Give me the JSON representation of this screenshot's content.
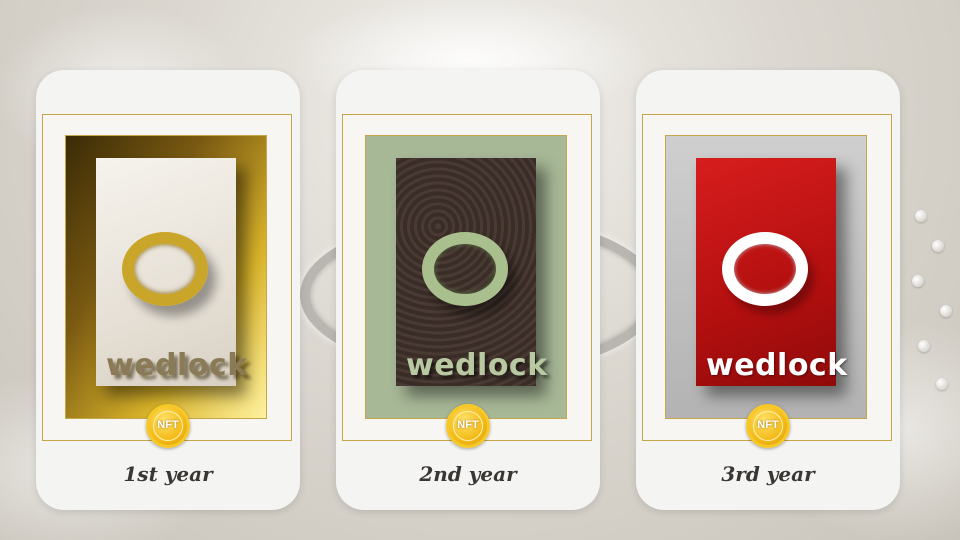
{
  "cards": [
    {
      "logo_text": "wedlock",
      "badge": "NFT",
      "caption": "1st year"
    },
    {
      "logo_text": "wedlock",
      "badge": "NFT",
      "caption": "2nd year"
    },
    {
      "logo_text": "wedlock",
      "badge": "NFT",
      "caption": "3rd year"
    }
  ],
  "colors": {
    "accent_gold": "#c7a64a",
    "card_bg": "#f4f4f2",
    "year1": "#c9a52a",
    "year2": "#a9c08e",
    "year3": "#d71d1d"
  },
  "icons": {
    "badge_icon": "nft-coin-icon"
  }
}
